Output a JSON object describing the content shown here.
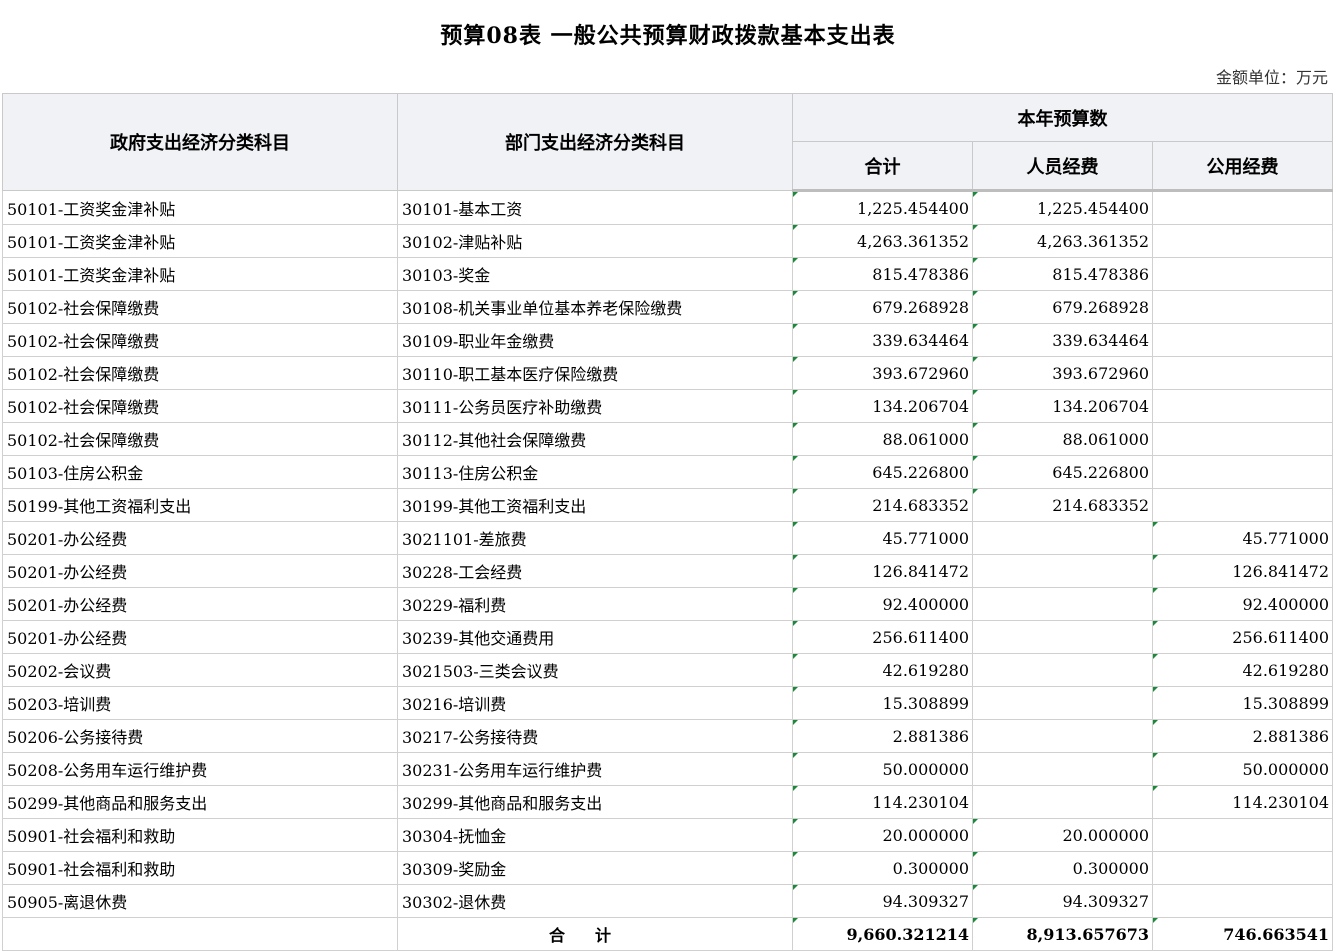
{
  "title": "预算08表  一般公共预算财政拨款基本支出表",
  "unit": "金额单位：万元",
  "headers": {
    "gov_category": "政府支出经济分类科目",
    "dept_category": "部门支出经济分类科目",
    "current_year": "本年预算数",
    "total": "合计",
    "personnel": "人员经费",
    "public": "公用经费"
  },
  "rows": [
    {
      "gov": "50101-工资奖金津补贴",
      "dept": "30101-基本工资",
      "total": "1,225.454400",
      "personnel": "1,225.454400",
      "public": ""
    },
    {
      "gov": "50101-工资奖金津补贴",
      "dept": "30102-津贴补贴",
      "total": "4,263.361352",
      "personnel": "4,263.361352",
      "public": ""
    },
    {
      "gov": "50101-工资奖金津补贴",
      "dept": "30103-奖金",
      "total": "815.478386",
      "personnel": "815.478386",
      "public": ""
    },
    {
      "gov": "50102-社会保障缴费",
      "dept": "30108-机关事业单位基本养老保险缴费",
      "total": "679.268928",
      "personnel": "679.268928",
      "public": ""
    },
    {
      "gov": "50102-社会保障缴费",
      "dept": "30109-职业年金缴费",
      "total": "339.634464",
      "personnel": "339.634464",
      "public": ""
    },
    {
      "gov": "50102-社会保障缴费",
      "dept": "30110-职工基本医疗保险缴费",
      "total": "393.672960",
      "personnel": "393.672960",
      "public": ""
    },
    {
      "gov": "50102-社会保障缴费",
      "dept": "30111-公务员医疗补助缴费",
      "total": "134.206704",
      "personnel": "134.206704",
      "public": ""
    },
    {
      "gov": "50102-社会保障缴费",
      "dept": "30112-其他社会保障缴费",
      "total": "88.061000",
      "personnel": "88.061000",
      "public": ""
    },
    {
      "gov": "50103-住房公积金",
      "dept": "30113-住房公积金",
      "total": "645.226800",
      "personnel": "645.226800",
      "public": ""
    },
    {
      "gov": "50199-其他工资福利支出",
      "dept": "30199-其他工资福利支出",
      "total": "214.683352",
      "personnel": "214.683352",
      "public": ""
    },
    {
      "gov": "50201-办公经费",
      "dept": "3021101-差旅费",
      "total": "45.771000",
      "personnel": "",
      "public": "45.771000"
    },
    {
      "gov": "50201-办公经费",
      "dept": "30228-工会经费",
      "total": "126.841472",
      "personnel": "",
      "public": "126.841472"
    },
    {
      "gov": "50201-办公经费",
      "dept": "30229-福利费",
      "total": "92.400000",
      "personnel": "",
      "public": "92.400000"
    },
    {
      "gov": "50201-办公经费",
      "dept": "30239-其他交通费用",
      "total": "256.611400",
      "personnel": "",
      "public": "256.611400"
    },
    {
      "gov": "50202-会议费",
      "dept": "3021503-三类会议费",
      "total": "42.619280",
      "personnel": "",
      "public": "42.619280"
    },
    {
      "gov": "50203-培训费",
      "dept": "30216-培训费",
      "total": "15.308899",
      "personnel": "",
      "public": "15.308899"
    },
    {
      "gov": "50206-公务接待费",
      "dept": "30217-公务接待费",
      "total": "2.881386",
      "personnel": "",
      "public": "2.881386"
    },
    {
      "gov": "50208-公务用车运行维护费",
      "dept": "30231-公务用车运行维护费",
      "total": "50.000000",
      "personnel": "",
      "public": "50.000000"
    },
    {
      "gov": "50299-其他商品和服务支出",
      "dept": "30299-其他商品和服务支出",
      "total": "114.230104",
      "personnel": "",
      "public": "114.230104"
    },
    {
      "gov": "50901-社会福利和救助",
      "dept": "30304-抚恤金",
      "total": "20.000000",
      "personnel": "20.000000",
      "public": ""
    },
    {
      "gov": "50901-社会福利和救助",
      "dept": "30309-奖励金",
      "total": "0.300000",
      "personnel": "0.300000",
      "public": ""
    },
    {
      "gov": "50905-离退休费",
      "dept": "30302-退休费",
      "total": "94.309327",
      "personnel": "94.309327",
      "public": ""
    }
  ],
  "total_row": {
    "label": "合计",
    "total": "9,660.321214",
    "personnel": "8,913.657673",
    "public": "746.663541"
  }
}
